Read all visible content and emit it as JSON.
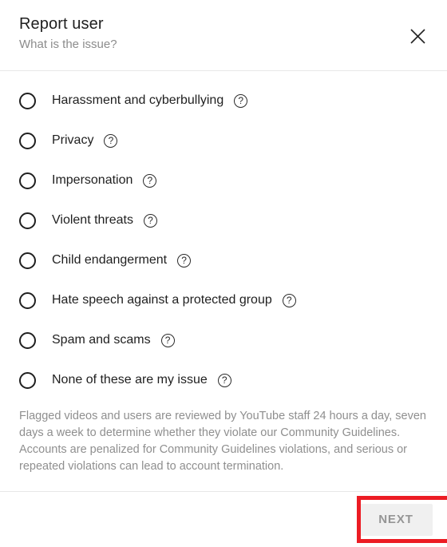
{
  "dialog": {
    "title": "Report user",
    "subtitle": "What is the issue?",
    "close_icon": "close-icon"
  },
  "options": [
    {
      "label": "Harassment and cyberbullying",
      "selected": false,
      "help": "?"
    },
    {
      "label": "Privacy",
      "selected": false,
      "help": "?"
    },
    {
      "label": "Impersonation",
      "selected": false,
      "help": "?"
    },
    {
      "label": "Violent threats",
      "selected": false,
      "help": "?"
    },
    {
      "label": "Child endangerment",
      "selected": false,
      "help": "?"
    },
    {
      "label": "Hate speech against a protected group",
      "selected": false,
      "help": "?"
    },
    {
      "label": "Spam and scams",
      "selected": false,
      "help": "?"
    },
    {
      "label": "None of these are my issue",
      "selected": false,
      "help": "?"
    }
  ],
  "disclaimer": "Flagged videos and users are reviewed by YouTube staff 24 hours a day, seven days a week to determine whether they violate our Community Guidelines. Accounts are penalized for Community Guidelines violations, and serious or repeated violations can lead to account termination.",
  "footer": {
    "next_label": "NEXT"
  },
  "annotation": {
    "color": "#ec1c24",
    "target": "next-button"
  }
}
